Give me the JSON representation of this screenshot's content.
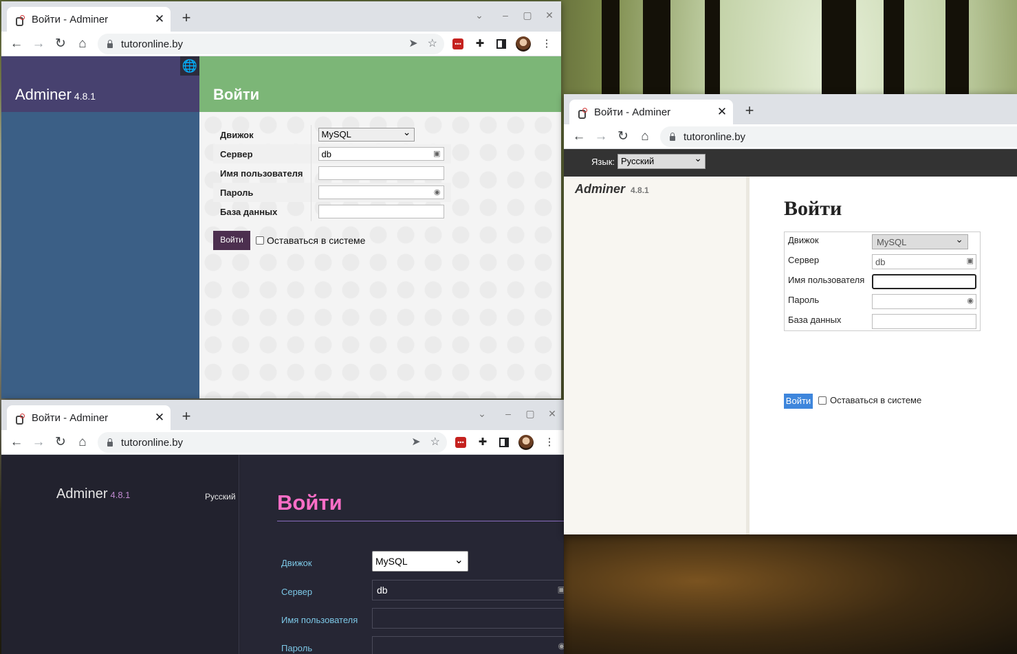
{
  "window1": {
    "tab_title": "Войти - Adminer",
    "url": "tutoronline.by",
    "brand": "Adminer",
    "version": "4.8.1",
    "heading": "Войти",
    "fields": [
      {
        "label": "Движок",
        "value": "MySQL"
      },
      {
        "label": "Сервер",
        "value": "db"
      },
      {
        "label": "Имя пользователя",
        "value": ""
      },
      {
        "label": "Пароль",
        "value": ""
      },
      {
        "label": "База данных",
        "value": ""
      }
    ],
    "login_button": "Войти",
    "remember_label": "Оставаться в системе",
    "colors": {
      "sidebar": "#3b5f86",
      "brand_header": "#47416f",
      "main_header": "#7cb677",
      "button": "#4c2f4f"
    }
  },
  "window2": {
    "tab_title": "Войти - Adminer",
    "url": "tutoronline.by",
    "lang_label": "Язык:",
    "lang_value": "Русский",
    "brand": "Adminer",
    "version": "4.8.1",
    "heading": "Войти",
    "fields": [
      {
        "label": "Движок",
        "value": "MySQL"
      },
      {
        "label": "Сервер",
        "value": "db"
      },
      {
        "label": "Имя пользователя",
        "value": ""
      },
      {
        "label": "Пароль",
        "value": ""
      },
      {
        "label": "База данных",
        "value": ""
      }
    ],
    "login_button": "Войти",
    "remember_label": "Оставаться в системе",
    "colors": {
      "button": "#3e86dc",
      "topbar": "#333333"
    }
  },
  "window3": {
    "tab_title": "Войти - Adminer",
    "url": "tutoronline.by",
    "brand": "Adminer",
    "version": "4.8.1",
    "lang_value": "Русский",
    "heading": "Войти",
    "fields": [
      {
        "label": "Движок",
        "value": "MySQL"
      },
      {
        "label": "Сервер",
        "value": "db"
      },
      {
        "label": "Имя пользователя",
        "value": ""
      },
      {
        "label": "Пароль",
        "value": ""
      }
    ],
    "colors": {
      "background": "#22222e",
      "heading": "#ff6ec7",
      "labels": "#7cc7e6"
    }
  },
  "icons": [
    "globe-icon",
    "back-icon",
    "forward-icon",
    "reload-icon",
    "home-icon",
    "lock-icon",
    "share-icon",
    "star-icon",
    "extensions-icon",
    "side-panel-icon",
    "menu-icon",
    "close-icon",
    "minimize-icon",
    "maximize-icon"
  ]
}
